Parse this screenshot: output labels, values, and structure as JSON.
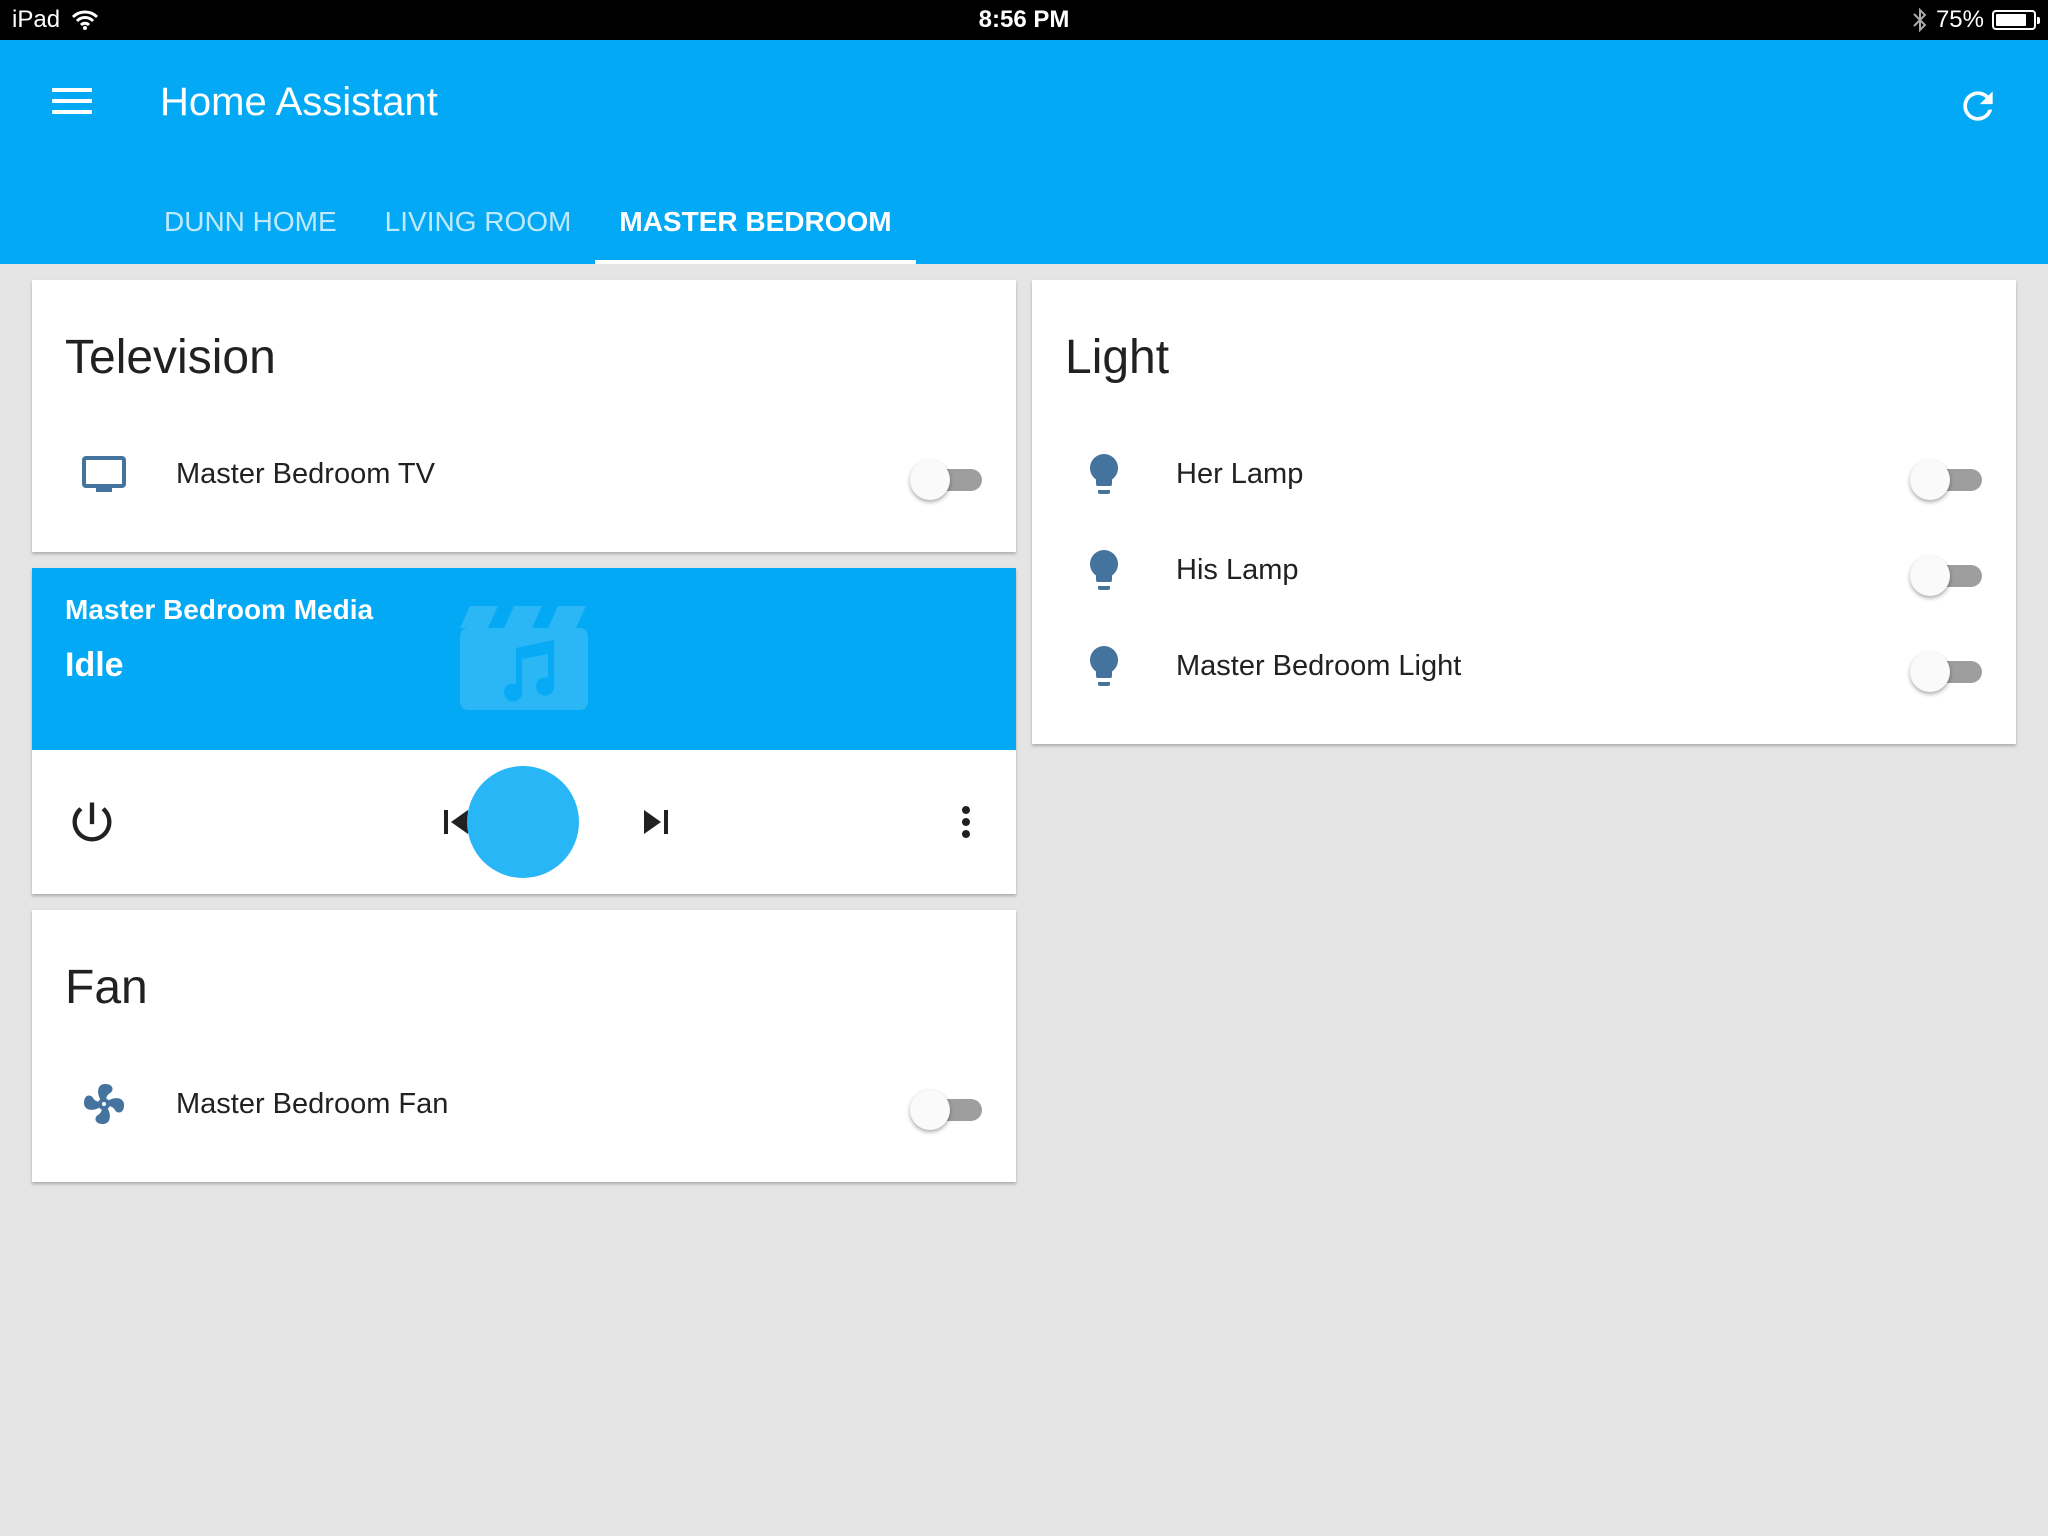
{
  "status_bar": {
    "device": "iPad",
    "time": "8:56 PM",
    "battery": "75%",
    "battery_level": 0.75
  },
  "header": {
    "title": "Home Assistant",
    "tabs": [
      {
        "label": "DUNN HOME",
        "active": false
      },
      {
        "label": "LIVING ROOM",
        "active": false
      },
      {
        "label": "MASTER BEDROOM",
        "active": true
      }
    ]
  },
  "colors": {
    "primary": "#03a9f4",
    "icon": "#44739e",
    "background": "#e5e5e5"
  },
  "cards": {
    "television": {
      "title": "Television",
      "items": [
        {
          "label": "Master Bedroom TV",
          "icon": "television-icon",
          "on": false
        }
      ]
    },
    "media": {
      "name": "Master Bedroom Media",
      "state": "Idle",
      "controls": [
        "power-icon",
        "skip-previous-icon",
        "play-button",
        "skip-next-icon",
        "more-vertical-icon"
      ]
    },
    "fan": {
      "title": "Fan",
      "items": [
        {
          "label": "Master Bedroom Fan",
          "icon": "fan-icon",
          "on": false
        }
      ]
    },
    "light": {
      "title": "Light",
      "items": [
        {
          "label": "Her Lamp",
          "icon": "lightbulb-icon",
          "on": false
        },
        {
          "label": "His Lamp",
          "icon": "lightbulb-icon",
          "on": false
        },
        {
          "label": "Master Bedroom Light",
          "icon": "lightbulb-icon",
          "on": false
        }
      ]
    }
  }
}
